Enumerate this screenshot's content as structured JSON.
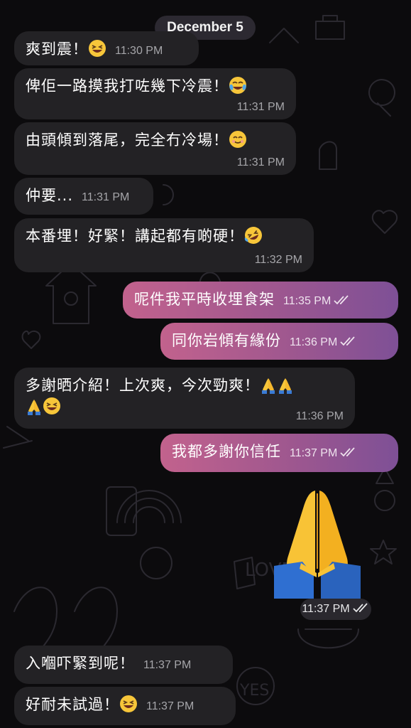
{
  "date_label": "December 5",
  "messages": [
    {
      "text": "爽到震！",
      "time": "11:30 PM"
    },
    {
      "text": "俾佢一路摸我打咗幾下冷震！",
      "time": "11:31 PM"
    },
    {
      "text": "由頭傾到落尾，完全冇冷場！",
      "time": "11:31 PM"
    },
    {
      "text": "仲要...",
      "time": "11:31 PM"
    },
    {
      "text": "本番埋！好緊！講起都有啲硬！",
      "time": "11:32 PM"
    },
    {
      "text": "呢件我平時收埋食架",
      "time": "11:35 PM"
    },
    {
      "text": "同你岩傾有緣份",
      "time": "11:36 PM"
    },
    {
      "text": "多謝晒介紹！上次爽，今次勁爽！",
      "time": "11:36 PM"
    },
    {
      "text": "我都多謝你信任",
      "time": "11:37 PM"
    },
    {
      "text": "",
      "time": "11:37 PM"
    },
    {
      "text": "入嗰吓緊到呢！",
      "time": "11:37 PM"
    },
    {
      "text": "好耐未試過！",
      "time": "11:37 PM"
    }
  ],
  "icons": {
    "grin": "grinning-squinting-face-icon",
    "tears": "face-with-tears-of-joy-icon",
    "smile": "smiling-face-icon",
    "rofl": "rolling-on-floor-laughing-icon",
    "pray": "folded-hands-icon",
    "read": "double-check-read-icon"
  },
  "colors": {
    "background": "#0c0b0d",
    "incoming_bubble": "#232225",
    "outgoing_start": "#c2628d",
    "outgoing_end": "#7e5096"
  }
}
